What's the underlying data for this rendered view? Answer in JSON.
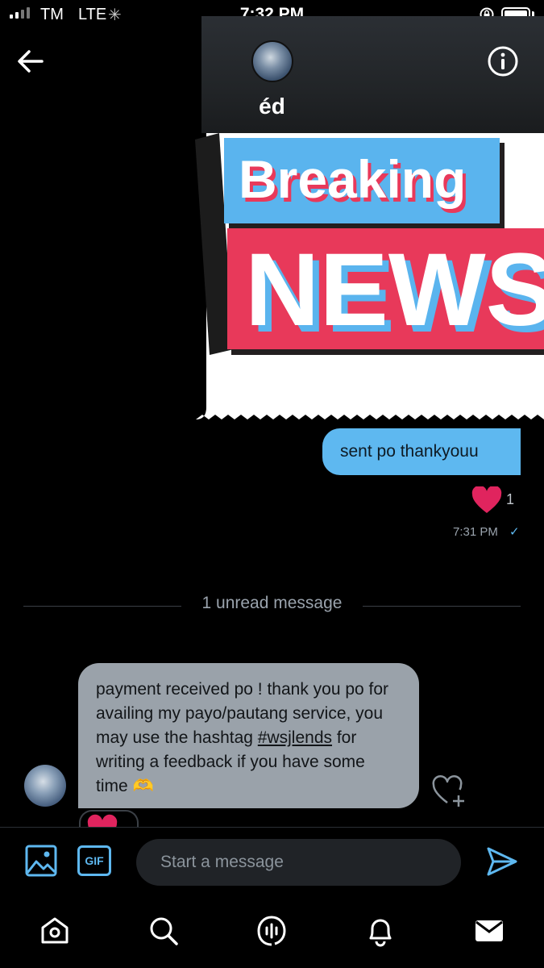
{
  "status_bar": {
    "carrier": "TM",
    "network": "LTE",
    "time": "7:32 PM"
  },
  "header": {
    "contact_name": "éd",
    "icons": {
      "back": "arrow-left-icon",
      "info": "info-icon"
    }
  },
  "media": {
    "headline_top": "Breaking",
    "headline_bottom": "NEWS"
  },
  "messages": {
    "sent": {
      "text": "sent po thankyouu",
      "reaction_count": "1",
      "time": "7:31 PM"
    },
    "divider": "1 unread message",
    "received": {
      "text_before": "payment received po ! thank you po for availing my payo/pautang service, you may use the hashtag ",
      "hashtag": "#wsjlends",
      "text_after": " for writing a feedback if you have some time 🫶"
    }
  },
  "composer": {
    "placeholder": "Start a message",
    "gif_label": "GIF"
  },
  "tab_bar": [
    "home-icon",
    "search-icon",
    "spaces-icon",
    "notifications-icon",
    "messages-icon"
  ],
  "colors": {
    "accent": "#5eb8f0",
    "received_bubble": "#9aa2aa",
    "heart": "#e0245e",
    "news_red": "#e8395a",
    "news_blue": "#5ab4ee"
  }
}
